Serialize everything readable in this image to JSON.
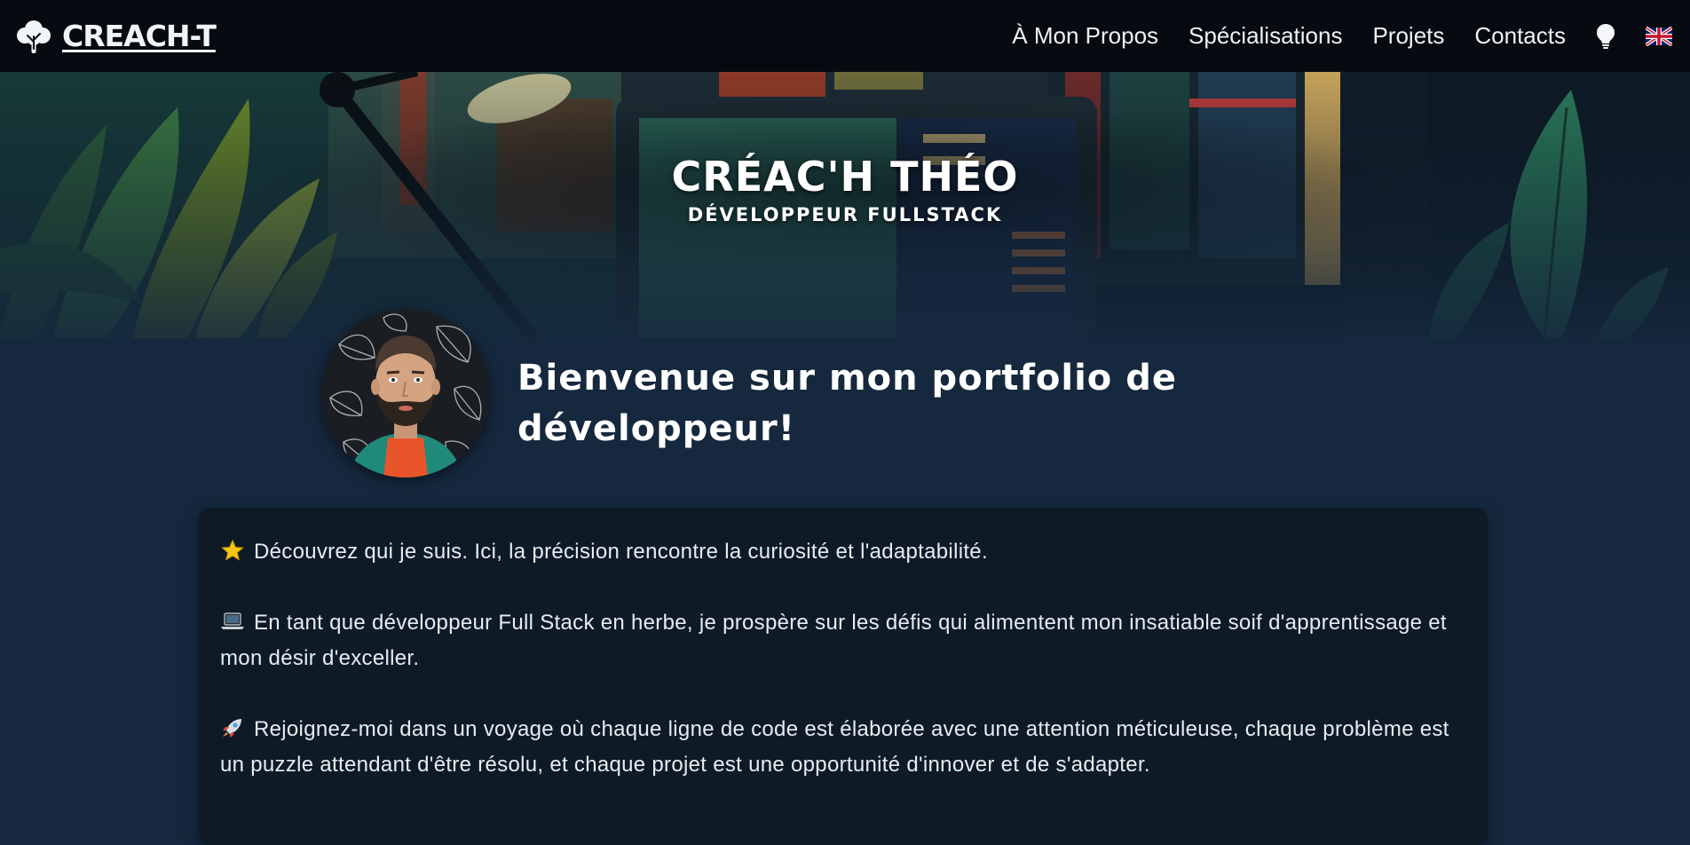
{
  "navbar": {
    "brand": "CREACH-T",
    "links": [
      "À Mon Propos",
      "Spécialisations",
      "Projets",
      "Contacts"
    ],
    "theme_icon": "lightbulb-icon",
    "language_icon": "uk-flag-icon"
  },
  "hero": {
    "name": "CRÉAC'H THÉO",
    "role": "DÉVELOPPEUR FULLSTACK"
  },
  "intro": {
    "welcome": "Bienvenue sur mon portfolio de développeur!"
  },
  "about": {
    "paragraphs": [
      {
        "icon": "star-icon",
        "text": "Découvrez qui je suis. Ici, la précision rencontre la curiosité et l'adaptabilité."
      },
      {
        "icon": "laptop-icon",
        "text": "En tant que développeur Full Stack en herbe, je prospère sur les défis qui alimentent mon insatiable soif d'apprentissage et mon désir d'exceller."
      },
      {
        "icon": "rocket-icon",
        "text": "Rejoignez-moi dans un voyage où chaque ligne de code est élaborée avec une attention méticuleuse, chaque problème est un puzzle attendant d'être résolu, et chaque projet est une opportunité d'innover et de s'adapter."
      }
    ]
  },
  "colors": {
    "navbar_bg": "#050b10",
    "page_bg": "#15283d",
    "card_bg": "#0e1b27",
    "text": "#ffffff"
  }
}
